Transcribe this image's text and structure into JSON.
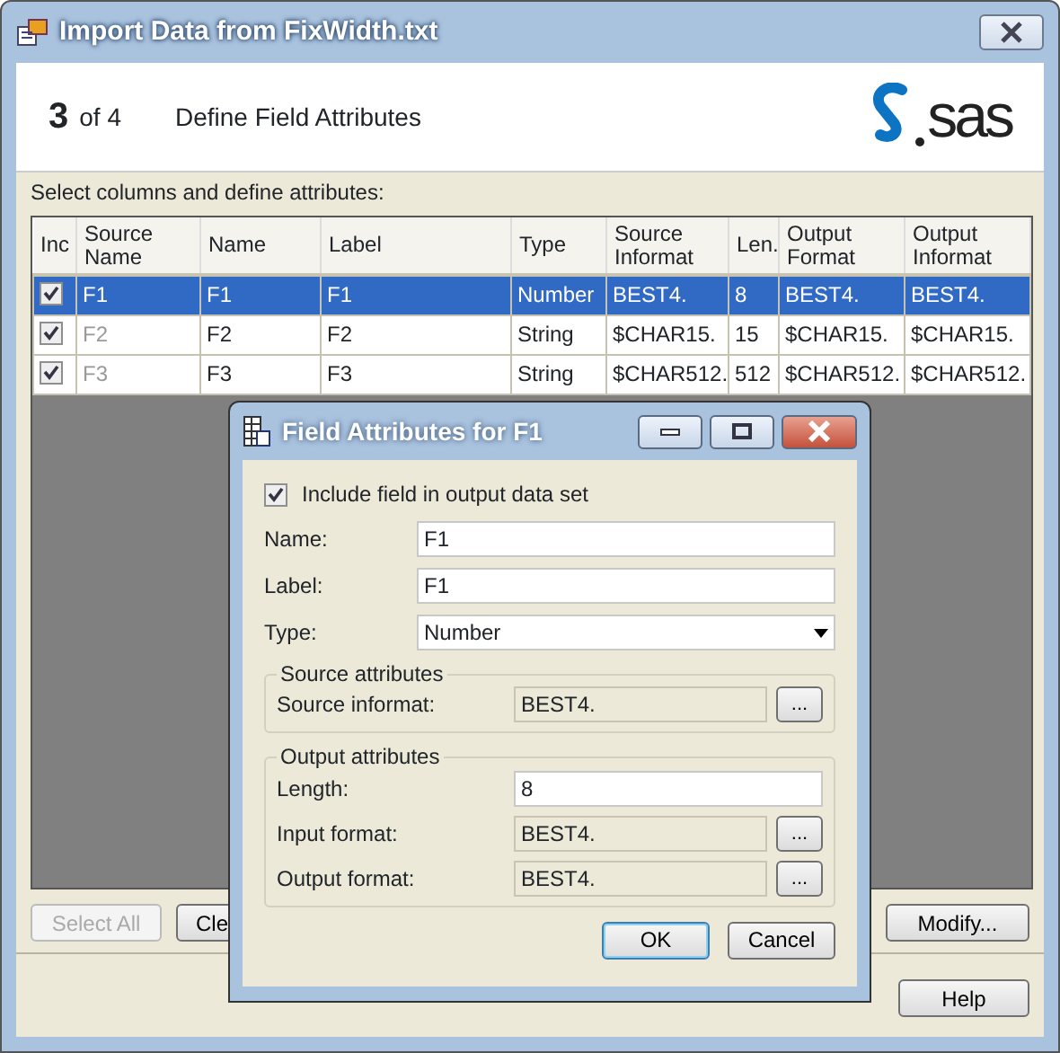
{
  "window": {
    "title": "Import Data from FixWidth.txt"
  },
  "header": {
    "step": "3",
    "of": "of 4",
    "title": "Define Field Attributes",
    "logo": "sas"
  },
  "instructions": "Select columns and define attributes:",
  "table": {
    "columns": [
      {
        "label": "Inc"
      },
      {
        "label": "Source Name",
        "read_only": true
      },
      {
        "label": "Name"
      },
      {
        "label": "Label"
      },
      {
        "label": "Type"
      },
      {
        "label": "Source Informat"
      },
      {
        "label": "Len."
      },
      {
        "label": "Output Format"
      },
      {
        "label": "Output Informat"
      }
    ],
    "rows": [
      {
        "selected": true,
        "included": true,
        "cells": [
          "",
          "F1",
          "F1",
          "F1",
          "Number",
          "BEST4.",
          "8",
          "BEST4.",
          "BEST4."
        ]
      },
      {
        "selected": false,
        "included": true,
        "cells": [
          "",
          "F2",
          "F2",
          "F2",
          "String",
          "$CHAR15.",
          "15",
          "$CHAR15.",
          "$CHAR15."
        ]
      },
      {
        "selected": false,
        "included": true,
        "cells": [
          "",
          "F3",
          "F3",
          "F3",
          "String",
          "$CHAR512.",
          "512",
          "$CHAR512.",
          "$CHAR512."
        ]
      }
    ]
  },
  "buttons": [
    {
      "label": "Select All",
      "disabled": true
    },
    {
      "label": "Cle",
      "disabled": false
    },
    {
      "label": "Modify...",
      "disabled": false
    }
  ],
  "footer_buttons": [
    {
      "label": "Help",
      "disabled": false
    }
  ],
  "dialog": {
    "title": "Field Attributes for F1",
    "browse_label": "...",
    "include": {
      "label": "Include field in output data set",
      "checked": true
    },
    "fields": [
      {
        "kind": "text",
        "label": "Name:",
        "value": "F1"
      },
      {
        "kind": "text",
        "label": "Label:",
        "value": "F1"
      },
      {
        "kind": "select",
        "label": "Type:",
        "value": "Number"
      }
    ],
    "groups": [
      {
        "title": "Source attributes",
        "fields": [
          {
            "kind": "browse",
            "label": "Source informat:",
            "value": "BEST4."
          }
        ]
      },
      {
        "title": "Output attributes",
        "fields": [
          {
            "kind": "text",
            "label": "Length:",
            "value": "8"
          },
          {
            "kind": "browse",
            "label": "Input format:",
            "value": "BEST4."
          },
          {
            "kind": "browse",
            "label": "Output format:",
            "value": "BEST4."
          }
        ]
      }
    ],
    "buttons": [
      {
        "label": "OK",
        "default": true
      },
      {
        "label": "Cancel",
        "default": false
      }
    ]
  }
}
